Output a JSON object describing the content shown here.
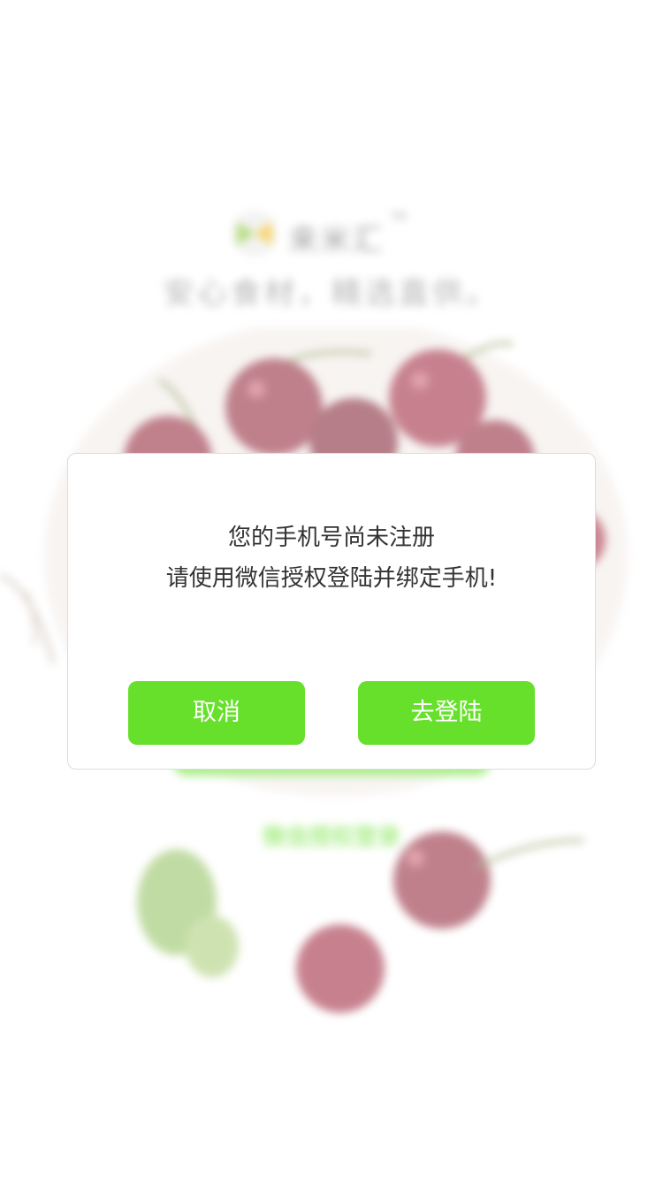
{
  "background": {
    "brand_name": "来米汇",
    "brand_tm": "TM",
    "slogan": "安心食材，精选直供。",
    "wechat_login_label": "微信授权登录"
  },
  "dialog": {
    "message_line1": "您的手机号尚未注册",
    "message_line2": "请使用微信授权登陆并绑定手机!",
    "cancel_label": "取消",
    "login_label": "去登陆"
  },
  "colors": {
    "accent": "#67e02c",
    "text": "#333333",
    "cherry": "#8b1a2e"
  },
  "icons": {
    "logo": "bowtie-logo-icon"
  }
}
